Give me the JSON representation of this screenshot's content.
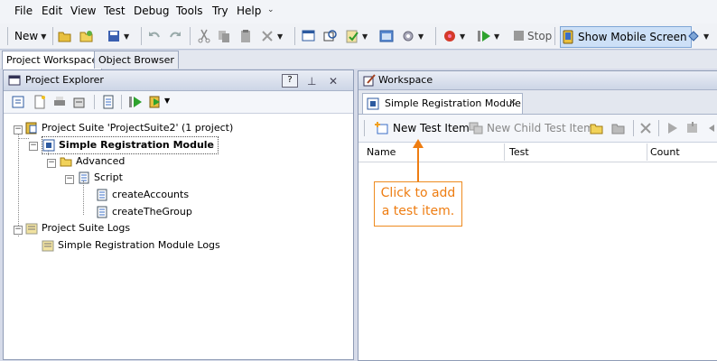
{
  "menu": [
    {
      "label": "File",
      "key": "F"
    },
    {
      "label": "Edit",
      "key": "E"
    },
    {
      "label": "View",
      "key": "V"
    },
    {
      "label": "Test",
      "key": "e"
    },
    {
      "label": "Debug",
      "key": "D"
    },
    {
      "label": "Tools",
      "key": "T"
    },
    {
      "label": "Try",
      "key": "r"
    },
    {
      "label": "Help",
      "key": "H"
    }
  ],
  "toolbar": {
    "new_label": "New",
    "stop_label": "Stop",
    "show_mobile_label": "Show Mobile Screen"
  },
  "left_tabs": {
    "project_workspace": "Project Workspace",
    "object_browser": "Object Browser"
  },
  "explorer": {
    "title": "Project Explorer",
    "help": "?",
    "tree": {
      "suite": "Project Suite 'ProjectSuite2' (1 project)",
      "module": "Simple Registration Module",
      "advanced": "Advanced",
      "script": "Script",
      "create_accounts": "createAccounts",
      "create_group": "createTheGroup",
      "suite_logs": "Project Suite Logs",
      "module_logs": "Simple Registration Module Logs"
    }
  },
  "workspace": {
    "title": "Workspace",
    "tab_label": "Simple Registration Module",
    "tab_close": "✕",
    "new_test_item": "New Test Item",
    "new_child_test_item": "New Child Test Item",
    "columns": [
      "Name",
      "Test",
      "Count"
    ]
  },
  "callout": {
    "line1": "Click to add",
    "line2": "a test item."
  },
  "colors": {
    "accent": "#ee7d12",
    "border": "#8f9cb6",
    "background": "#d6dbe9"
  }
}
